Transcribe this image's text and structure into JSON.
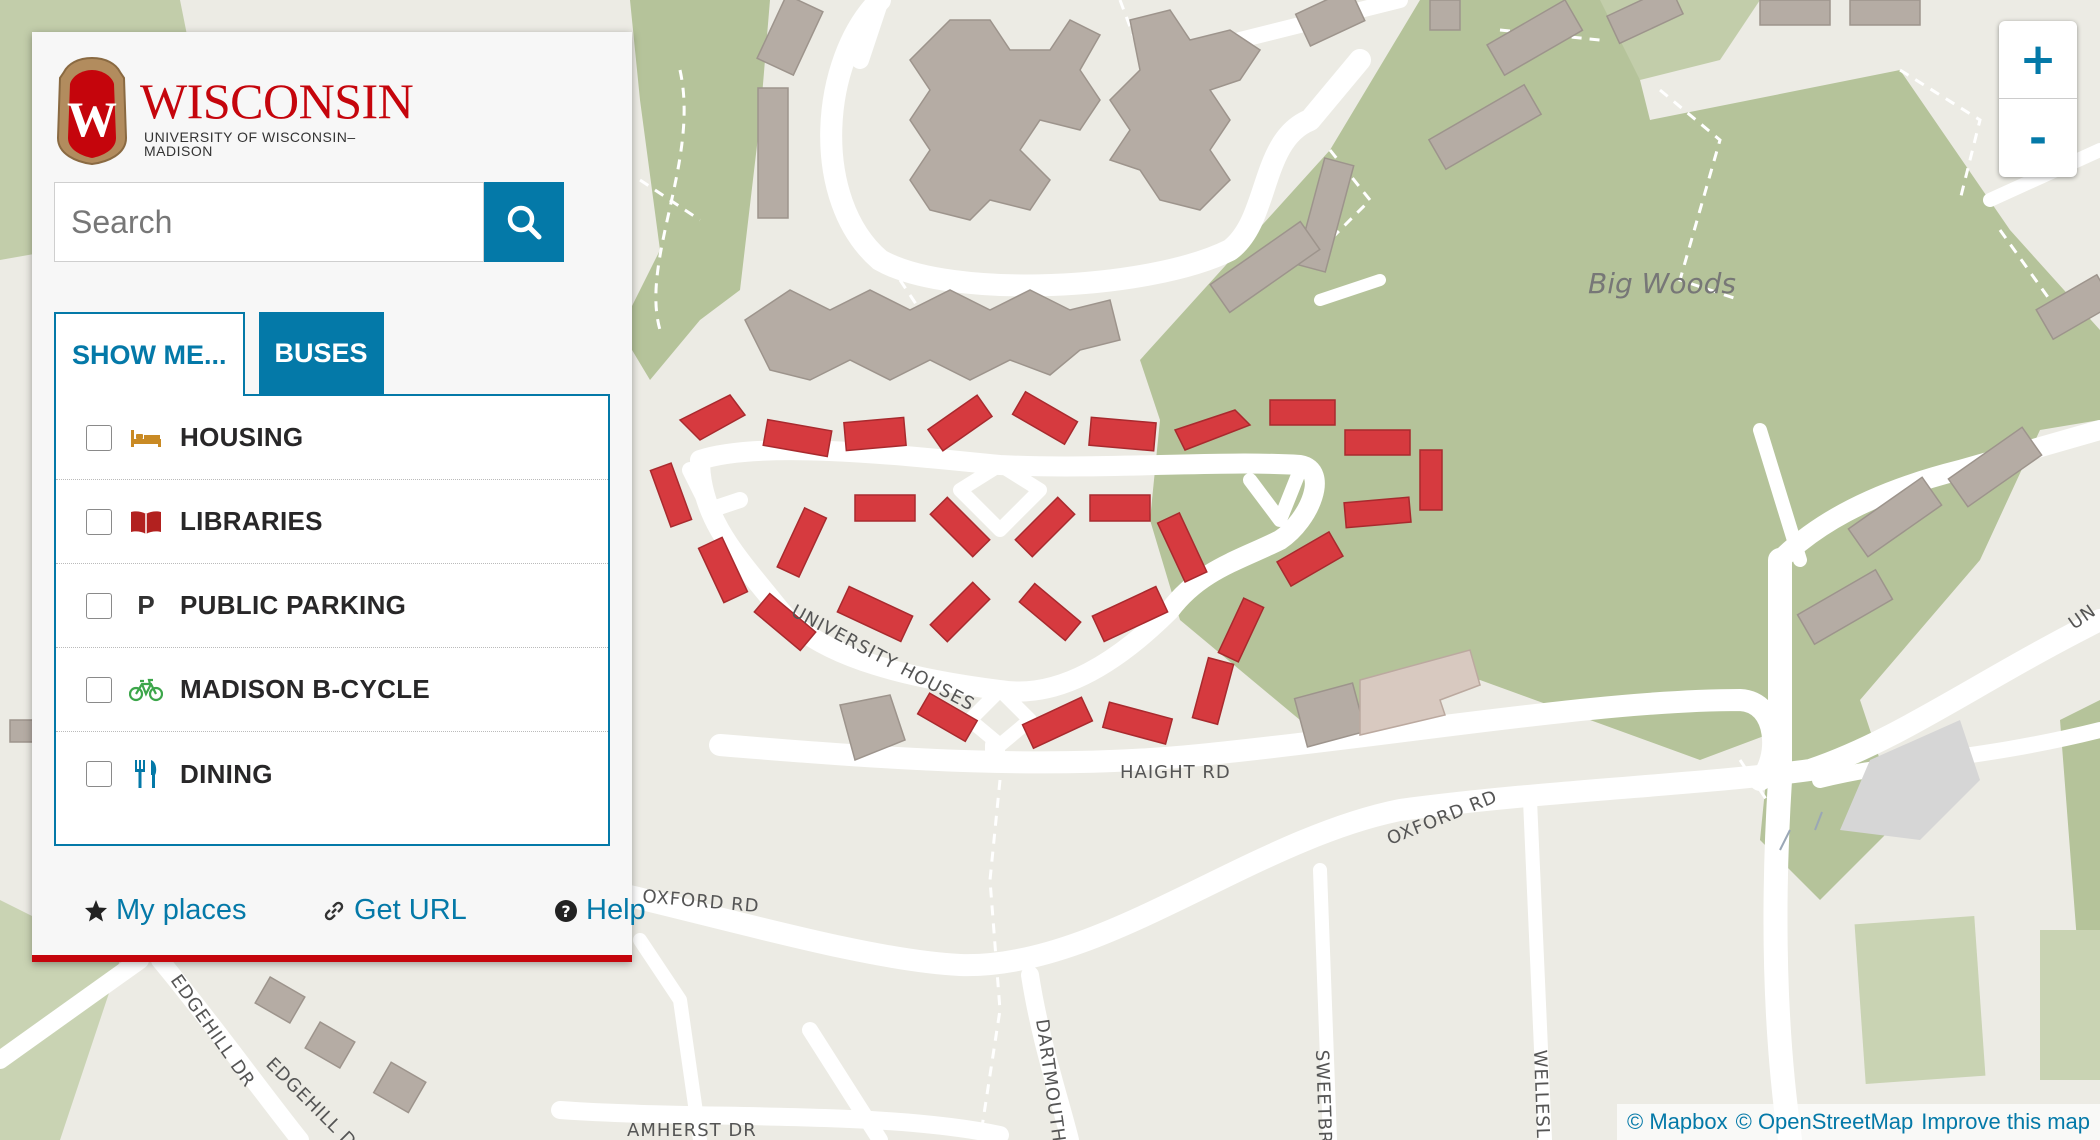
{
  "logo": {
    "wordmark": "WISCONSIN",
    "subtitle": "UNIVERSITY OF WISCONSIN–MADISON"
  },
  "search": {
    "placeholder": "Search"
  },
  "tabs": [
    {
      "label": "SHOW ME...",
      "active": true
    },
    {
      "label": "BUSES",
      "active": false
    }
  ],
  "layers": [
    {
      "label": "HOUSING",
      "icon": "bed-icon",
      "color": "#c98a24",
      "checked": false
    },
    {
      "label": "LIBRARIES",
      "icon": "book-icon",
      "color": "#b2211f",
      "checked": false
    },
    {
      "label": "PUBLIC PARKING",
      "icon": "parking-icon",
      "symbol": "P",
      "color": "#333333",
      "checked": false
    },
    {
      "label": "MADISON B-CYCLE",
      "icon": "bicycle-icon",
      "color": "#3ca64a",
      "checked": false
    },
    {
      "label": "DINING",
      "icon": "fork-knife-icon",
      "color": "#0479a8",
      "checked": false
    }
  ],
  "footer": {
    "my_places": "My places",
    "get_url": "Get URL",
    "help": "Help"
  },
  "zoom": {
    "in": "+",
    "out": "-"
  },
  "map": {
    "area_label": "Big Woods",
    "roads": {
      "university_houses": "UNIVERSITY HOUSES",
      "haight": "HAIGHT RD",
      "oxford_1": "OXFORD RD",
      "oxford_2": "OXFORD RD",
      "amherst": "AMHERST DR",
      "dartmouth": "DARTMOUTH",
      "sweetbr": "SWEETBR",
      "wellesl": "WELLESL",
      "edgehill_1": "EDGEHILL DR",
      "edgehill_2": "EDGEHILL D",
      "un": "UN"
    }
  },
  "attribution": {
    "mapbox": "© Mapbox",
    "osm": "© OpenStreetMap",
    "improve": "Improve this map"
  },
  "colors": {
    "brand_red": "#c5050c",
    "brand_blue": "#0479a8",
    "highlight_building": "#d63a3f",
    "building": "#b5aca4",
    "woods": "#b5c39a",
    "road": "#ffffff",
    "land": "#ecebe4"
  }
}
